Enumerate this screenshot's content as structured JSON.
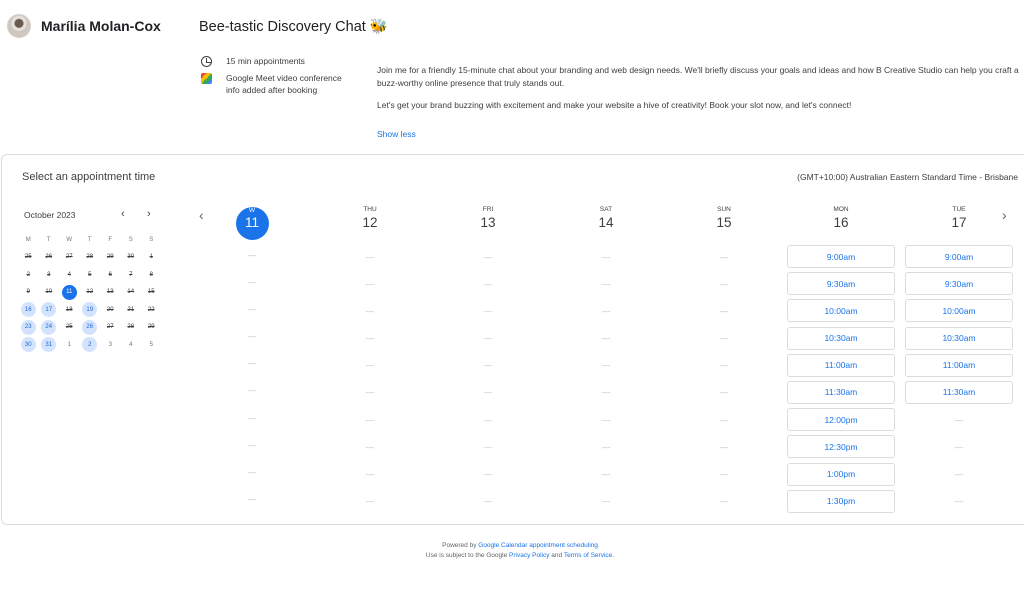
{
  "host": {
    "name": "Marília Molan-Cox"
  },
  "event": {
    "title": "Bee-tastic Discovery Chat 🐝",
    "duration": "15 min appointments",
    "conference": "Google Meet video conference info added after booking",
    "description_1": "Join me for a friendly 15-minute chat about your branding and web design needs. We'll briefly discuss your goals and ideas and how B Creative Studio can help you craft a buzz-worthy online presence that truly stands out.",
    "description_2": "Let's get your brand buzzing with excitement and make your website a hive of creativity! Book your slot now, and let's connect!",
    "show_less": "Show less"
  },
  "booking": {
    "title": "Select an appointment time",
    "timezone": "(GMT+10:00) Australian Eastern Standard Time - Brisbane"
  },
  "mini_calendar": {
    "month_label": "October 2023",
    "prev_icon": "chevron-left-icon",
    "next_icon": "chevron-right-icon",
    "weekdays": [
      "M",
      "T",
      "W",
      "T",
      "F",
      "S",
      "S"
    ],
    "weeks": [
      [
        {
          "d": "25",
          "s": "struck"
        },
        {
          "d": "26",
          "s": "struck"
        },
        {
          "d": "27",
          "s": "struck"
        },
        {
          "d": "28",
          "s": "struck"
        },
        {
          "d": "29",
          "s": "struck"
        },
        {
          "d": "30",
          "s": "struck"
        },
        {
          "d": "1",
          "s": "struck"
        }
      ],
      [
        {
          "d": "2",
          "s": "struck"
        },
        {
          "d": "3",
          "s": "struck"
        },
        {
          "d": "4",
          "s": "struck"
        },
        {
          "d": "5",
          "s": "struck"
        },
        {
          "d": "6",
          "s": "struck"
        },
        {
          "d": "7",
          "s": "struck"
        },
        {
          "d": "8",
          "s": "struck"
        }
      ],
      [
        {
          "d": "9",
          "s": "struck"
        },
        {
          "d": "10",
          "s": "struck"
        },
        {
          "d": "11",
          "s": "selected"
        },
        {
          "d": "12",
          "s": "struck"
        },
        {
          "d": "13",
          "s": "struck"
        },
        {
          "d": "14",
          "s": "struck"
        },
        {
          "d": "15",
          "s": "struck"
        }
      ],
      [
        {
          "d": "16",
          "s": "available"
        },
        {
          "d": "17",
          "s": "available"
        },
        {
          "d": "18",
          "s": "struck"
        },
        {
          "d": "19",
          "s": "available"
        },
        {
          "d": "20",
          "s": "struck"
        },
        {
          "d": "21",
          "s": "struck"
        },
        {
          "d": "22",
          "s": "struck"
        }
      ],
      [
        {
          "d": "23",
          "s": "available"
        },
        {
          "d": "24",
          "s": "available"
        },
        {
          "d": "25",
          "s": "struck"
        },
        {
          "d": "26",
          "s": "available"
        },
        {
          "d": "27",
          "s": "struck"
        },
        {
          "d": "28",
          "s": "struck"
        },
        {
          "d": "29",
          "s": "struck"
        }
      ],
      [
        {
          "d": "30",
          "s": "available"
        },
        {
          "d": "31",
          "s": "available"
        },
        {
          "d": "1",
          "s": "muted"
        },
        {
          "d": "2",
          "s": "available"
        },
        {
          "d": "3",
          "s": "muted"
        },
        {
          "d": "4",
          "s": "muted"
        },
        {
          "d": "5",
          "s": "muted"
        }
      ]
    ]
  },
  "week_view": {
    "prev_icon": "chevron-left-icon",
    "next_icon": "chevron-right-icon",
    "days": [
      {
        "dow": "W",
        "date": "11",
        "today": true,
        "slots": []
      },
      {
        "dow": "THU",
        "date": "12",
        "slots": []
      },
      {
        "dow": "FRI",
        "date": "13",
        "slots": []
      },
      {
        "dow": "SAT",
        "date": "14",
        "slots": []
      },
      {
        "dow": "SUN",
        "date": "15",
        "slots": []
      },
      {
        "dow": "MON",
        "date": "16",
        "slots": [
          "9:00am",
          "9:30am",
          "10:00am",
          "10:30am",
          "11:00am",
          "11:30am",
          "12:00pm",
          "12:30pm",
          "1:00pm",
          "1:30pm"
        ]
      },
      {
        "dow": "TUE",
        "date": "17",
        "slots": [
          "9:00am",
          "9:30am",
          "10:00am",
          "10:30am",
          "11:00am",
          "11:30am"
        ]
      }
    ],
    "empty_marker": "—",
    "rows": 10
  },
  "footer": {
    "powered_prefix": "Powered by",
    "powered_link": "Google Calendar appointment scheduling",
    "terms_prefix": "Use is subject to the Google",
    "privacy_link": "Privacy Policy",
    "and": "and",
    "terms_link": "Terms of Service"
  }
}
